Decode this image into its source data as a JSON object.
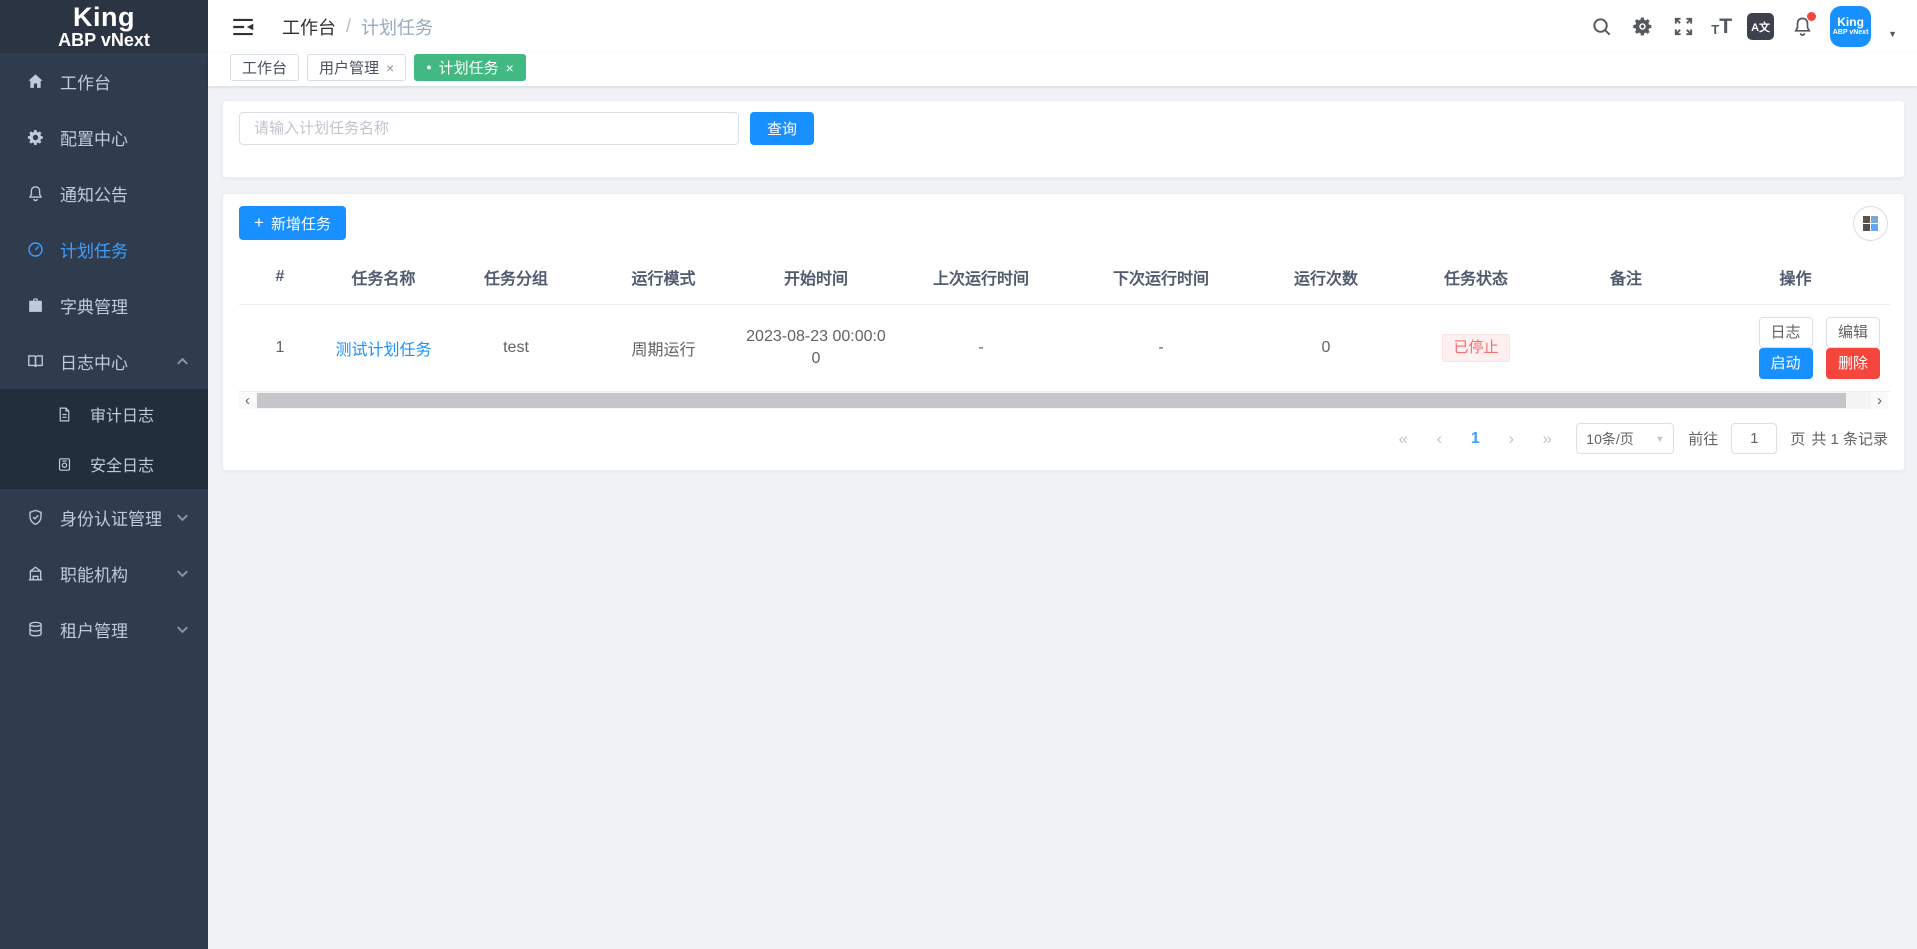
{
  "logo": {
    "line1": "King",
    "line2": "ABP vNext"
  },
  "sidebar": {
    "items": [
      {
        "label": "工作台"
      },
      {
        "label": "配置中心"
      },
      {
        "label": "通知公告"
      },
      {
        "label": "计划任务"
      },
      {
        "label": "字典管理"
      },
      {
        "label": "日志中心"
      },
      {
        "label": "审计日志"
      },
      {
        "label": "安全日志"
      },
      {
        "label": "身份认证管理"
      },
      {
        "label": "职能机构"
      },
      {
        "label": "租户管理"
      }
    ]
  },
  "header": {
    "breadcrumb": {
      "home": "工作台",
      "separator": "/",
      "current": "计划任务"
    },
    "language_icon_text": "A文",
    "avatar": {
      "line1": "King",
      "line2": "ABP vNext"
    }
  },
  "tabs": [
    {
      "label": "工作台"
    },
    {
      "label": "用户管理"
    },
    {
      "label": "计划任务"
    }
  ],
  "search": {
    "placeholder": "请输入计划任务名称",
    "query_button": "查询"
  },
  "toolbar": {
    "add_button": "新增任务"
  },
  "table": {
    "columns": [
      "#",
      "任务名称",
      "任务分组",
      "运行模式",
      "开始时间",
      "上次运行时间",
      "下次运行时间",
      "运行次数",
      "任务状态",
      "备注",
      "操作"
    ],
    "rows": [
      {
        "index": "1",
        "name": "测试计划任务",
        "group": "test",
        "mode": "周期运行",
        "start_time": "2023-08-23 00:00:00",
        "last_run_time": "-",
        "next_run_time": "-",
        "run_count": "0",
        "status": "已停止",
        "remark": "",
        "actions": {
          "log": "日志",
          "edit": "编辑",
          "start": "启动",
          "delete": "删除"
        }
      }
    ]
  },
  "pagination": {
    "page": "1",
    "page_size": "10条/页",
    "goto_label": "前往",
    "goto_value": "1",
    "page_unit": "页",
    "total": "共 1 条记录"
  },
  "icons": {
    "add": "+",
    "close": "×",
    "tab_dot": "●",
    "caret_down": "▼",
    "prev": "‹",
    "next": "›",
    "first": "«",
    "last": "»",
    "font_t": "T"
  },
  "colors": {
    "primary": "#1890ff",
    "active_tab_green": "#42b983",
    "danger": "#f5463d",
    "status_stopped_bg": "#fef0f0",
    "status_stopped_text": "#f56c6c",
    "sidebar_bg": "#2f3c4e",
    "sidebar_submenu_bg": "#232e3d",
    "link": "#1890ff"
  }
}
